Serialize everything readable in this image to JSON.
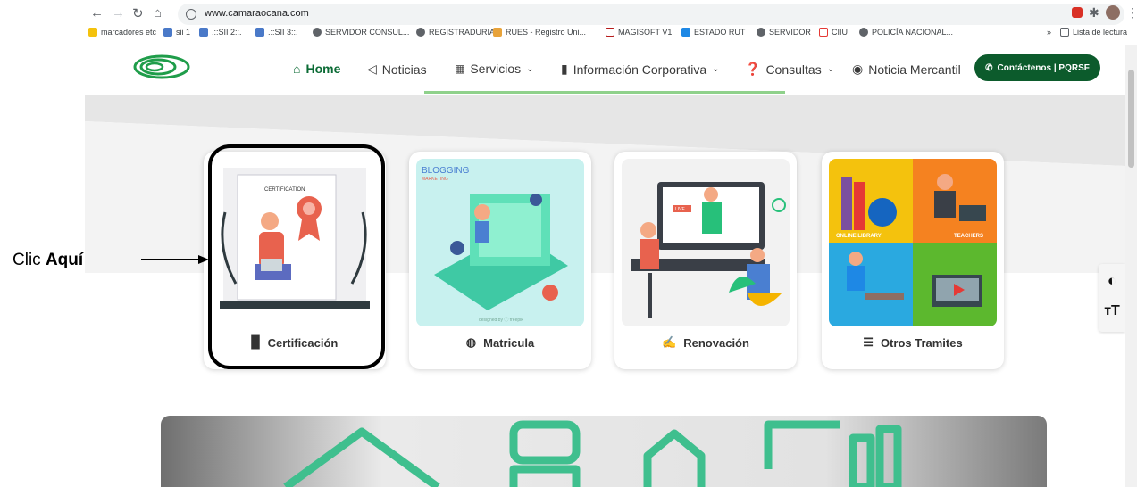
{
  "browser": {
    "url": "www.camaraocana.com",
    "bookmarks": [
      "marcadores etc",
      "sii 1",
      ".::SII 2::.",
      ".::SII 3::.",
      "SERVIDOR CONSUL...",
      "REGISTRADURIA",
      "RUES - Registro Uni...",
      "MAGISOFT V1",
      "ESTADO RUT",
      "SERVIDOR",
      "CIIU",
      "POLICÍA NACIONAL..."
    ],
    "more_bookmarks": "»",
    "reading_list": "Lista de lectura"
  },
  "nav": {
    "home": "Home",
    "news": "Noticias",
    "services": "Servicios",
    "corporate": "Información Corporativa",
    "queries": "Consultas",
    "commercial_news": "Noticia Mercantil",
    "contact": "Contáctenos | PQRSF"
  },
  "cards": [
    {
      "label": "Certificación",
      "icon": "document-icon"
    },
    {
      "label": "Matricula",
      "icon": "fingerprint-icon"
    },
    {
      "label": "Renovación",
      "icon": "signature-icon"
    },
    {
      "label": "Otros Tramites",
      "icon": "database-icon"
    }
  ],
  "card_art": {
    "certificate_text": "CERTIFICATION",
    "blogging_title": "BLOGGING",
    "blogging_sub": "MARKETING",
    "designed_by": "designed by ⓕ freepik",
    "live_tag": "LIVE",
    "online_library": "ONLINE LIBRARY",
    "teachers": "TEACHERS"
  },
  "annotation": {
    "prefix": "Clic ",
    "bold": "Aquí"
  },
  "colors": {
    "brand_green": "#0c5b2c",
    "accent_green": "#8fd18b",
    "banner_green": "#3fbf8e"
  }
}
